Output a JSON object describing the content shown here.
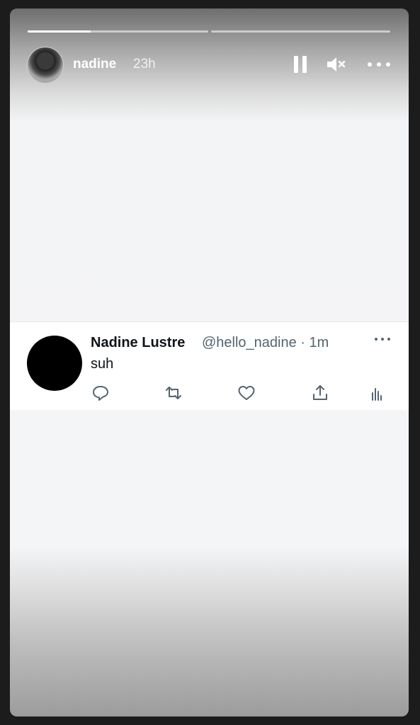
{
  "story": {
    "username": "nadine",
    "time": "23h",
    "progress": [
      0.35,
      0.0
    ],
    "icons": {
      "avatar": "profile-photo",
      "pause": "pause-icon",
      "mute": "speaker-muted-icon",
      "more": "more-dots-icon"
    }
  },
  "tweet": {
    "name": "Nadine Lustre",
    "handle": "@hello_nadine · 1m",
    "text": "suh",
    "actions": [
      "reply-icon",
      "retweet-icon",
      "like-icon",
      "share-icon",
      "analytics-icon"
    ]
  },
  "colors": {
    "text_primary": "#0f1419",
    "text_secondary": "#536471",
    "icon": "#536471"
  }
}
